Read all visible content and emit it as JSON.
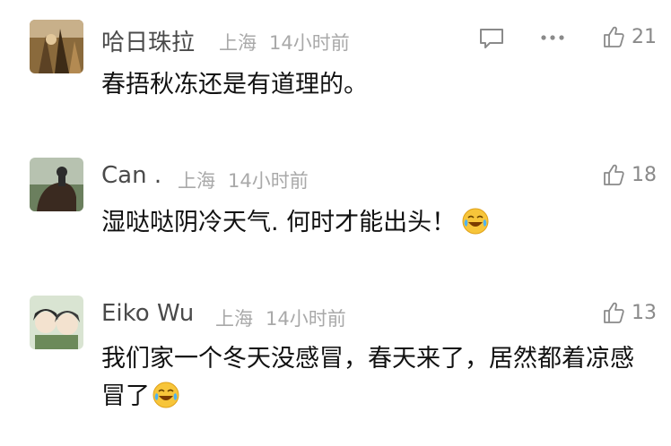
{
  "comments": [
    {
      "user": "哈日珠拉",
      "location": "上海",
      "time": "14小时前",
      "text": "春捂秋冻还是有道理的。",
      "likes": "21",
      "has_reply_icon": true,
      "has_more_icon": true
    },
    {
      "user": "Can .",
      "location": "上海",
      "time": "14小时前",
      "text": "湿哒哒阴冷天气. 何时才能出头！",
      "likes": "18",
      "emoji": "laugh-cry-emoji"
    },
    {
      "user": "Eiko Wu",
      "location": "上海",
      "time": "14小时前",
      "text": "我们家一个冬天没感冒，春天来了，居然都着凉感冒了",
      "likes": "13",
      "emoji": "laugh-cry-emoji"
    }
  ],
  "icons": {
    "reply": "comment-bubble-icon",
    "more": "more-dots-icon",
    "like": "thumbs-up-icon"
  },
  "colors": {
    "username": "#4a4a4a",
    "meta": "#a9a9a9",
    "text": "#111111",
    "icon": "#8a8a8a"
  }
}
